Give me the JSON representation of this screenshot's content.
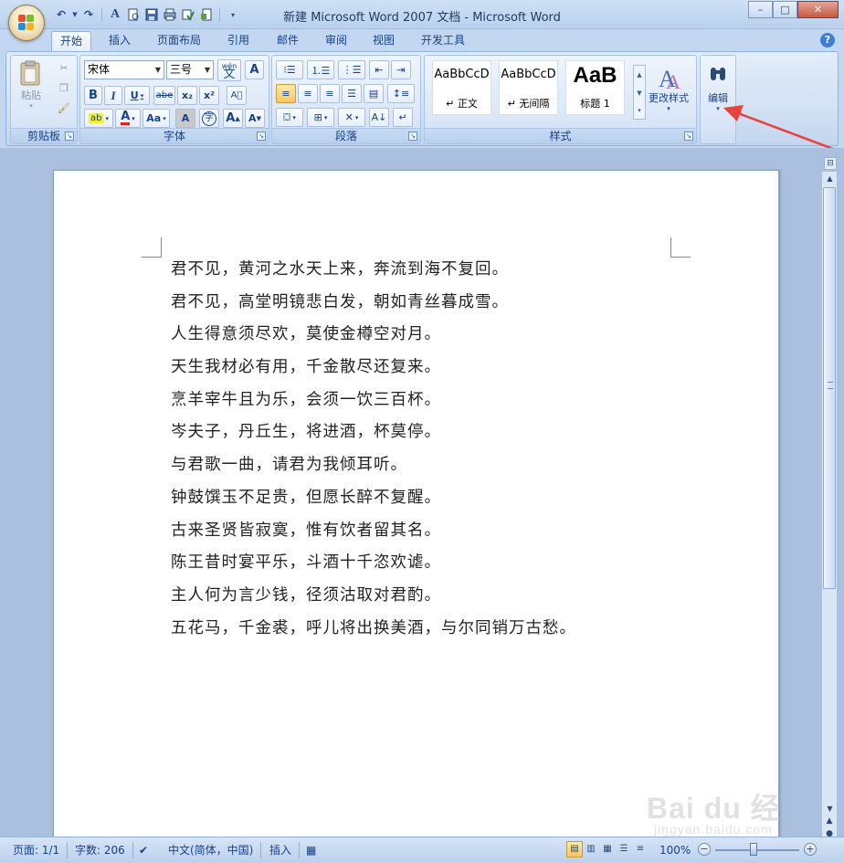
{
  "window": {
    "title": "新建 Microsoft Word 2007 文档 - Microsoft Word",
    "controls": [
      "–",
      "□",
      "✕"
    ]
  },
  "quick_access": {
    "undo": "↶",
    "redo": "↷",
    "icons": [
      "undo-icon",
      "redo-icon",
      "font-a-icon",
      "print-preview-icon",
      "save-icon",
      "print-icon",
      "spelling-icon",
      "new-icon",
      "customize-icon"
    ]
  },
  "tabs": [
    "开始",
    "插入",
    "页面布局",
    "引用",
    "邮件",
    "审阅",
    "视图",
    "开发工具"
  ],
  "active_tab": "开始",
  "ribbon": {
    "clipboard": {
      "label": "剪贴板",
      "paste": "粘贴"
    },
    "font": {
      "label": "字体",
      "font_name": "宋体",
      "font_size": "三号",
      "wen": "wén\n文",
      "bold": "B",
      "italic": "I",
      "underline": "U",
      "strike": "abe",
      "sub": "x₂",
      "sup": "x²",
      "clear": "A",
      "color_a": "A",
      "aa": "Aa",
      "char_a": "A",
      "enclose": "字",
      "grow": "A",
      "shrink": "A"
    },
    "paragraph": {
      "label": "段落"
    },
    "styles": {
      "label": "样式",
      "cards": [
        {
          "sample": "AaBbCcD",
          "name": "↵ 正文"
        },
        {
          "sample": "AaBbCcD",
          "name": "↵ 无间隔"
        },
        {
          "sample": "AaB",
          "name": "标题 1"
        }
      ],
      "change_styles": "更改样式"
    },
    "editing": {
      "label": "编辑"
    }
  },
  "document": {
    "lines": [
      "君不见，黄河之水天上来，奔流到海不复回。",
      "君不见，高堂明镜悲白发，朝如青丝暮成雪。",
      "人生得意须尽欢，莫使金樽空对月。",
      "天生我材必有用，千金散尽还复来。",
      "烹羊宰牛且为乐，会须一饮三百杯。",
      "岑夫子，丹丘生，将进酒，杯莫停。",
      "与君歌一曲，请君为我倾耳听。",
      "钟鼓馔玉不足贵，但愿长醉不复醒。",
      "古来圣贤皆寂寞，惟有饮者留其名。",
      "陈王昔时宴平乐，斗酒十千恣欢谑。",
      "主人何为言少钱，径须沽取对君酌。",
      "五花马，千金裘，呼儿将出换美酒，与尔同销万古愁。"
    ]
  },
  "statusbar": {
    "page": "页面: 1/1",
    "words": "字数: 206",
    "language": "中文(简体，中国)",
    "mode": "插入",
    "zoom": "100%",
    "zoom_minus": "−",
    "zoom_plus": "+"
  },
  "watermark": {
    "main": "Bai du 经验",
    "sub": "jingyan.baidu.com"
  },
  "colors": {
    "accent": "#15428b",
    "annotation_arrow": "#e8413e"
  }
}
